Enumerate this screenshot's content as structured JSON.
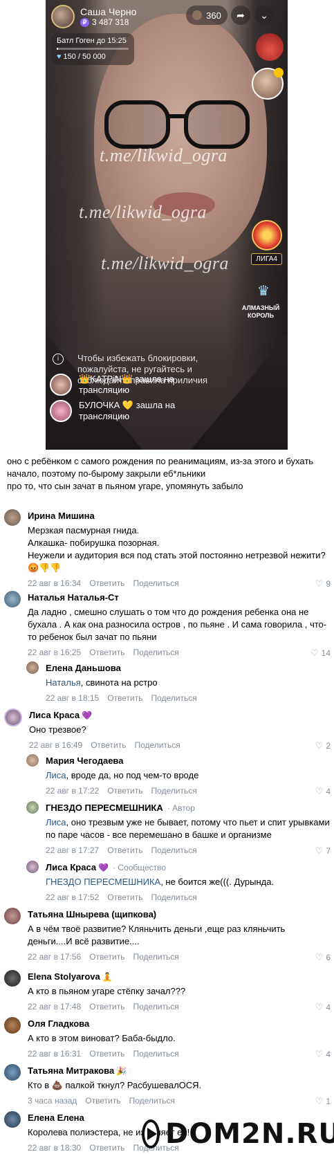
{
  "stream": {
    "host_name": "Саша Черно",
    "coin_symbol": "₽",
    "coins": "3 487 318",
    "viewers": "360",
    "battle_title": "Батл Гоген до 15:25",
    "battle_value": "150 / 50 000",
    "battle_progress": 0.003,
    "watermark": "t.me/likwid_ogra",
    "league_label": "ЛИГА4",
    "diamond_label": "АЛМАЗНЫЙ КОРОЛЬ",
    "warning": "Чтобы избежать блокировки, пожалуйста, не ругайтесь и соблюдайте правила приличия",
    "joins": [
      {
        "text": "👑KATPiN👑 зашла на трансляцию"
      },
      {
        "text": "БУЛОЧКА 💛 зашла на трансляцию"
      }
    ]
  },
  "post": {
    "line1": "оно с ребёнком с самого рождения по реанимациям, из-за этого и бухать",
    "line2": "начало, поэтому по-быромy закрыли еб*льники",
    "line3": "про то, что сын зачат в пьяном угаре, упомянуть забыло"
  },
  "actions": {
    "reply": "Ответить",
    "share": "Поделиться"
  },
  "comments": [
    {
      "author": "Ирина Мишина",
      "text": "Мерзкая пасмурная гнида.\nАлкашка- побирушка позорная.\nНеужели и аудитория вся под стать этой постоянно нетрезвой нежити?\n😡👎👎",
      "time": "22 авг в 16:34",
      "likes": "9"
    },
    {
      "author": "Наталья Наталья-Ст",
      "text": "Да ладно , смешно слушать о том что до рождения ребенка она не бухала . А как она разносила остров , по пьяне . И сама говорила , что-то ребенок был зачат по пьяни",
      "time": "22 авг в 16:25",
      "likes": "14"
    },
    {
      "author": "Елена Даньшова",
      "mention": "Наталья",
      "text": ", свинота на рстро",
      "time": "22 авг в 18:15",
      "likes": ""
    },
    {
      "author": "Лиса Краса",
      "emo": "💜",
      "text": "Оно трезвое?",
      "time": "22 авг в 16:49",
      "likes": "2"
    },
    {
      "author": "Мария Чегодаева",
      "mention": "Лиса",
      "text": ", вроде да, но под чем-то вроде",
      "time": "22 авг в 17:22",
      "likes": "4"
    },
    {
      "author": "ГНЕЗДО ПЕРЕСМЕШНИКА",
      "tag": "· Автор",
      "mention": "Лиса",
      "text": ", оно трезвым уже не бывает, потому что пьет и спит урывками по паре часов - все перемешано в башке и организме",
      "time": "22 авг в 17:27",
      "likes": "7"
    },
    {
      "author": "Лиса Краса",
      "emo": "💜",
      "tag": "· Сообщество",
      "mention": "ГНЕЗДО ПЕРЕСМЕШНИКА",
      "text": ", не боится же(((. Дурында.",
      "time": "22 авг в 17:52",
      "likes": ""
    },
    {
      "author": "Татьяна Шнырева (щипкова)",
      "text": "А в чём твоё развитие? Кляньчить деньги ,еще раз кляньчить деньги....И всё развитие....",
      "time": "22 авг в 17:56",
      "likes": "6"
    },
    {
      "author": "Elena Stolyarova",
      "emo": "🧘",
      "text": "А кто в пьяном угаре стёпку зачал???",
      "time": "22 авг в 17:48",
      "likes": "4"
    },
    {
      "author": "Оля Гладкова",
      "text": "А кто в этом виноват? Баба-быдло.",
      "time": "22 авг в 16:31",
      "likes": "4"
    },
    {
      "author": "Татьяна Митракова",
      "emo": "🎉",
      "text": "Кто в 💩 палкой ткнул? РасбушевалОСЯ.",
      "time": "3 часа назад",
      "likes": "1"
    },
    {
      "author": "Елена Елена",
      "text": "Королева полиэстера, не изменяет ей!",
      "time": "22 авг в 18:30",
      "likes": ""
    }
  ],
  "logo": {
    "text": "DOM2N.RU"
  },
  "colors": {
    "link": "#2a5885",
    "meta": "#818c99"
  }
}
